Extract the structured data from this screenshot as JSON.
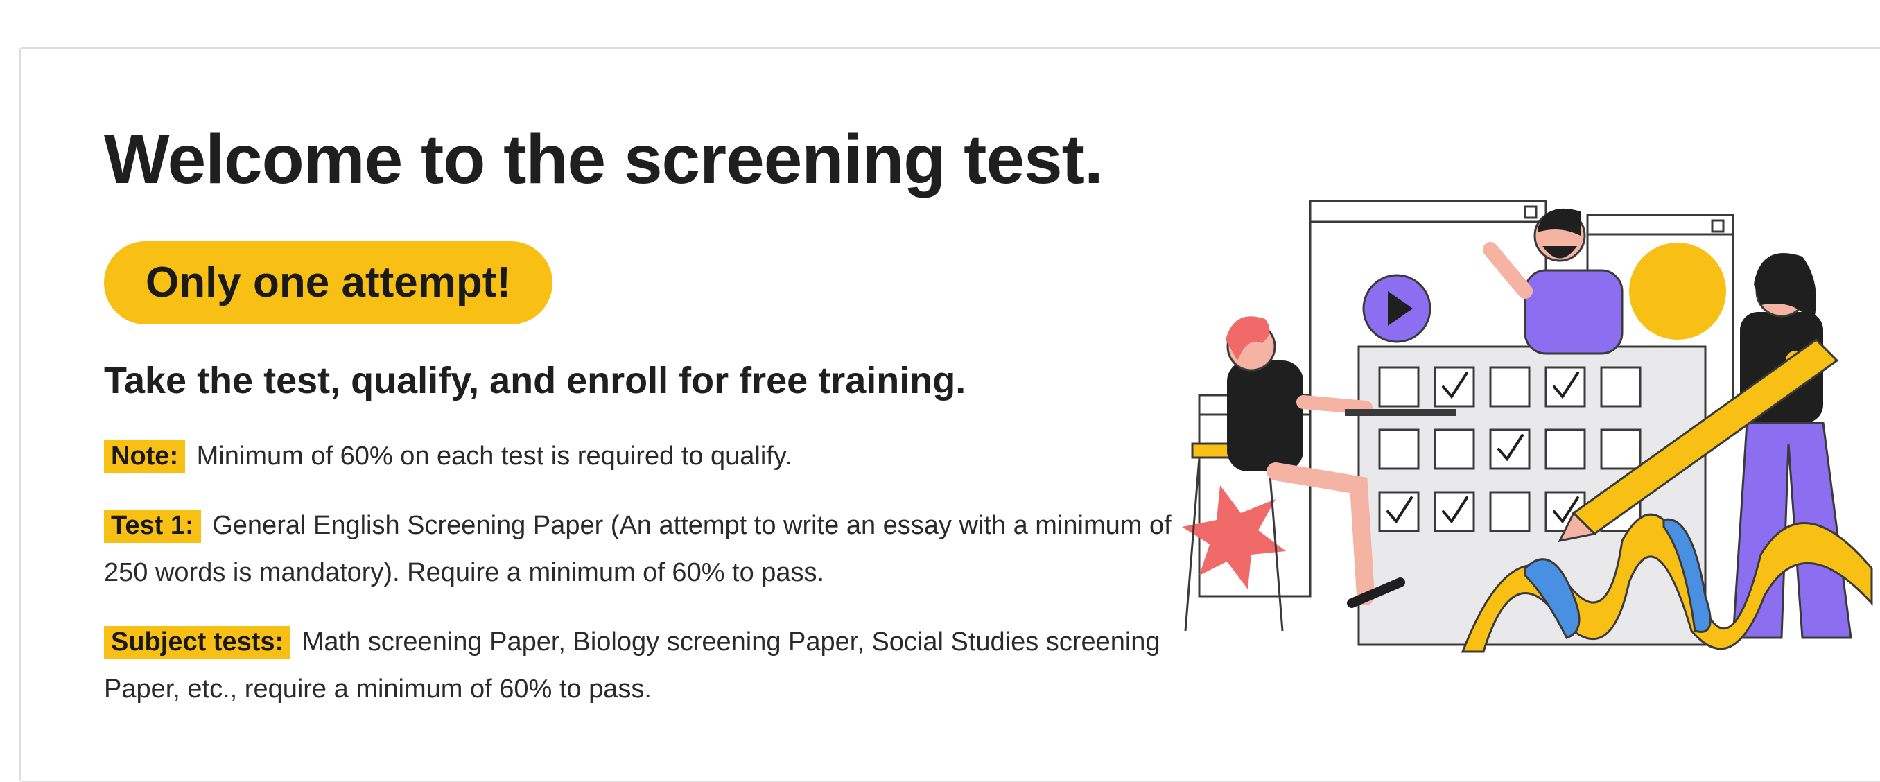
{
  "header": {
    "title": "Welcome to the screening test.",
    "attempt_badge": "Only one attempt!",
    "subtitle": "Take the test, qualify, and enroll for free training."
  },
  "notes": [
    {
      "label": "Note:",
      "text": "Minimum of 60% on each test is required to qualify."
    },
    {
      "label": "Test 1:",
      "text": "General English Screening Paper (An attempt to write an essay with a minimum of 250 words is mandatory). Require a minimum of 60% to pass."
    },
    {
      "label": "Subject tests:",
      "text": "Math screening Paper, Biology screening Paper, Social Studies screening Paper, etc., require a minimum of 60% to pass."
    }
  ],
  "illustration": {
    "icon": "test-checklist-illustration",
    "colors": {
      "accent_yellow": "#f8bf14",
      "purple": "#8c6ff0",
      "blue": "#4a90e2",
      "pink": "#f06a6a"
    }
  }
}
